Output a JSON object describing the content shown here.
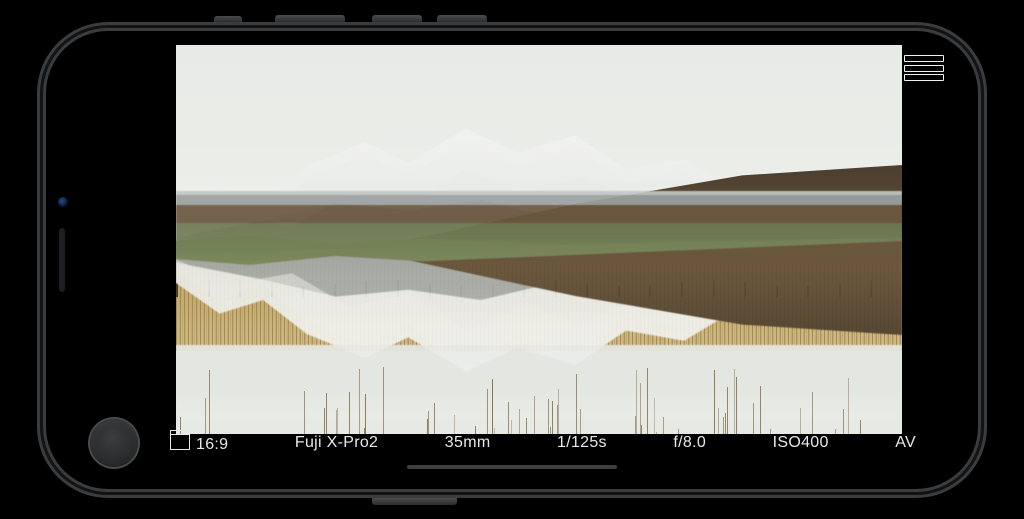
{
  "info": {
    "aspect_ratio": "16:9",
    "camera_model": "Fuji X-Pro2",
    "focal_length": "35mm",
    "shutter_speed": "1/125s",
    "aperture": "f/8.0",
    "iso": "ISO400",
    "mode": "AV"
  },
  "icons": {
    "menu": "hamburger-icon",
    "shutter": "shutter-button",
    "aspect": "aspect-ratio-icon"
  },
  "scene": {
    "description": "Snow-capped mountain range reflected in still water behind golden reeds, overcast sky",
    "fence_posts": 24,
    "foreground_stalks": 60
  }
}
